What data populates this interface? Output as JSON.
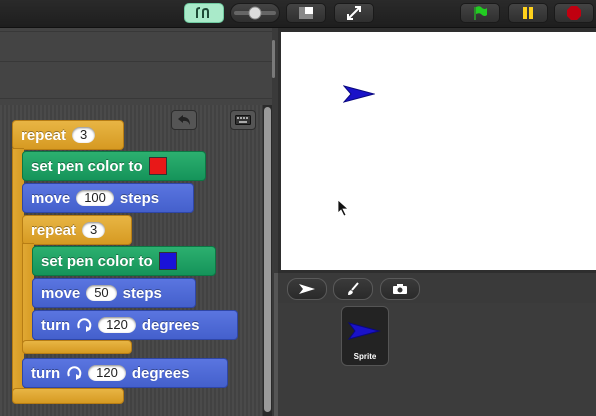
{
  "colors": {
    "red_swatch": "#e81818",
    "blue_swatch": "#1a12d8",
    "sprite_color": "#1a12c8"
  },
  "topbar": {
    "icons": [
      "app-switch-icon",
      "slider-icon",
      "stage-size-icon",
      "fullscreen-icon",
      "green-flag-icon",
      "pause-icon",
      "stop-icon"
    ]
  },
  "scripts": {
    "outer_repeat": {
      "label": "repeat",
      "count": "3"
    },
    "set_pen_red": {
      "label": "set pen color to"
    },
    "move_100": {
      "label": "move",
      "value": "100",
      "suffix": "steps"
    },
    "inner_repeat": {
      "label": "repeat",
      "count": "3"
    },
    "set_pen_blue": {
      "label": "set pen color to"
    },
    "move_50": {
      "label": "move",
      "value": "50",
      "suffix": "steps"
    },
    "turn_inner": {
      "label": "turn",
      "value": "120",
      "suffix": "degrees"
    },
    "turn_outer": {
      "label": "turn",
      "value": "120",
      "suffix": "degrees"
    }
  },
  "corral": {
    "sprite_name": "Sprite"
  }
}
